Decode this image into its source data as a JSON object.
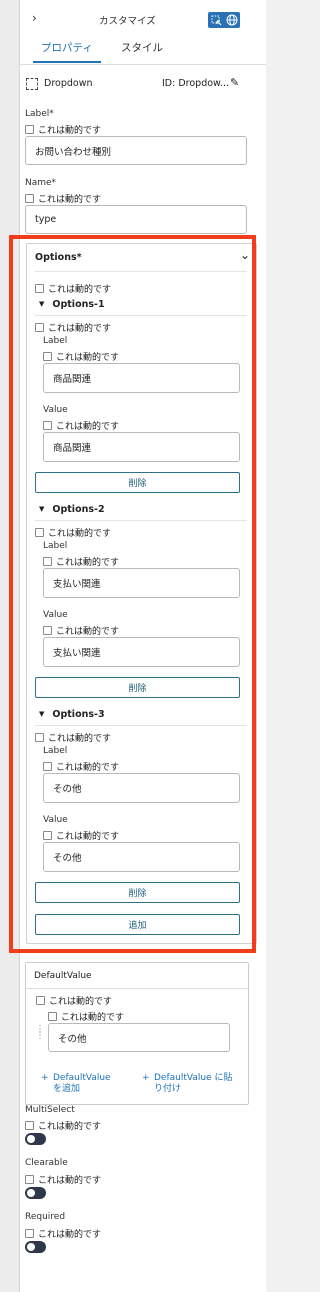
{
  "header": {
    "title": "カスタマイズ"
  },
  "tabs": [
    {
      "label": "プロパティ"
    },
    {
      "label": "スタイル"
    }
  ],
  "component": {
    "name": "Dropdown",
    "id": "ID: Dropdow..."
  },
  "dynamic_label": "これは動的です",
  "fields": {
    "label": {
      "title": "Label*",
      "value": "お問い合わせ種別"
    },
    "name": {
      "title": "Name*",
      "value": "type"
    }
  },
  "options": {
    "title": "Options*",
    "items": [
      {
        "title": "Options-1",
        "label_title": "Label",
        "label_value": "商品関連",
        "value_title": "Value",
        "value_value": "商品関連",
        "delete_label": "削除"
      },
      {
        "title": "Options-2",
        "label_title": "Label",
        "label_value": "支払い関連",
        "value_title": "Value",
        "value_value": "支払い関連",
        "delete_label": "削除"
      },
      {
        "title": "Options-3",
        "label_title": "Label",
        "label_value": "その他",
        "value_title": "Value",
        "value_value": "その他",
        "delete_label": "削除"
      }
    ],
    "add_label": "追加"
  },
  "default_value": {
    "title": "DefaultValue",
    "value": "その他",
    "add_link": "DefaultValue\nを追加",
    "paste_link": "DefaultValue に貼\nり付け"
  },
  "toggles": [
    {
      "title": "MultiSelect",
      "on": false
    },
    {
      "title": "Clearable",
      "on": false
    },
    {
      "title": "Required",
      "on": false
    }
  ],
  "colors": {
    "accent": "#1e73b8",
    "highlight": "#f33c1c",
    "toggle": "#2d3848"
  },
  "icons": {
    "collapse": "chevron-right-icon",
    "select": "select-area-icon",
    "globe": "globe-icon",
    "edit": "pencil-icon",
    "component": "dashed-square-icon",
    "options_chevron": "chevron-down-icon",
    "grip": "drag-handle-icon",
    "add": "plus-icon"
  }
}
